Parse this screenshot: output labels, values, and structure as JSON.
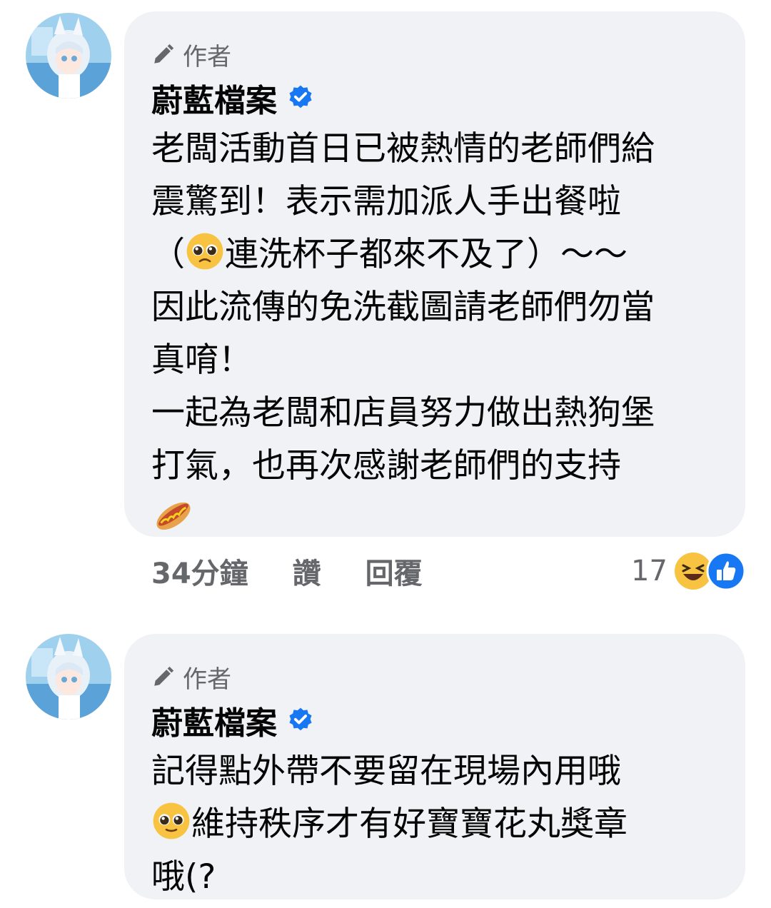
{
  "comments": [
    {
      "badge": "作者",
      "author": "蔚藍檔案",
      "lines": [
        "老闆活動首日已被熱情的老師們給",
        "震驚到！表示需加派人手出餐啦",
        "連洗杯子都來不及了）～～",
        "因此流傳的免洗截圖請老師們勿當",
        "真唷！",
        "一起為老闆和店員努力做出熱狗堡",
        "打氣，也再次感謝老師們的支持"
      ],
      "line3_prefix": "（",
      "time": "34分鐘",
      "like_label": "讚",
      "reply_label": "回覆",
      "reaction_count": "17",
      "emoji_icons": [
        "pleading-face-icon",
        "hotdog-icon"
      ],
      "reaction_icons": [
        "laughing-reaction-icon",
        "like-reaction-icon"
      ]
    },
    {
      "badge": "作者",
      "author": "蔚藍檔案",
      "lines": [
        "記得點外帶不要留在現場內用哦",
        "維持秩序才有好寶寶花丸獎章",
        "哦(?"
      ],
      "emoji_icons": [
        "pleading-face-icon"
      ]
    }
  ],
  "colors": {
    "bubble": "#f0f2f5",
    "secondary_text": "#65676b",
    "verified": "#1877f2"
  }
}
